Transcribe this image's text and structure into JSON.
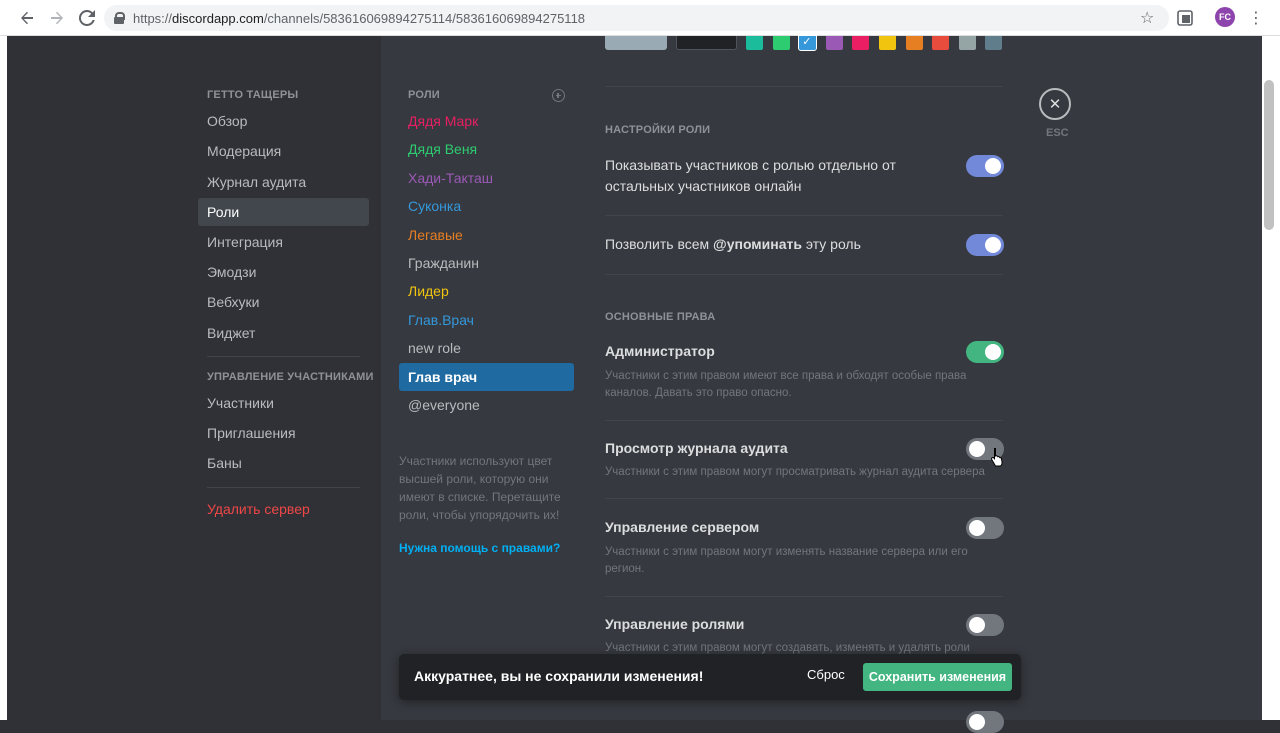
{
  "browser": {
    "url_scheme": "https://",
    "url_host": "discordapp.com",
    "url_path": "/channels/583616069894275114/583616069894275118",
    "avatar_initials": "FC"
  },
  "sidebar": {
    "server_section": "ГЕТТО ТАЩЕРЫ",
    "items": [
      {
        "label": "Обзор"
      },
      {
        "label": "Модерация"
      },
      {
        "label": "Журнал аудита"
      },
      {
        "label": "Роли",
        "active": true
      },
      {
        "label": "Интеграция"
      },
      {
        "label": "Эмодзи"
      },
      {
        "label": "Вебхуки"
      },
      {
        "label": "Виджет"
      }
    ],
    "members_section": "УПРАВЛЕНИЕ УЧАСТНИКАМИ",
    "member_items": [
      {
        "label": "Участники"
      },
      {
        "label": "Приглашения"
      },
      {
        "label": "Баны"
      }
    ],
    "delete_label": "Удалить сервер"
  },
  "roles": {
    "title": "РОЛИ",
    "items": [
      {
        "label": "Дядя Марк",
        "color": "#e91e63"
      },
      {
        "label": "Дядя Веня",
        "color": "#2ecc71"
      },
      {
        "label": "Хади-Такташ",
        "color": "#9b59b6"
      },
      {
        "label": "Суконка",
        "color": "#3498db"
      },
      {
        "label": "Легавые",
        "color": "#e67e22"
      },
      {
        "label": "Гражданин",
        "color": "#b9bbbe"
      },
      {
        "label": "Лидер",
        "color": "#f1c40f"
      },
      {
        "label": "Глав.Врач",
        "color": "#3498db"
      },
      {
        "label": "new role",
        "color": "#b9bbbe"
      },
      {
        "label": "Глав врач",
        "color": "#ffffff",
        "active": true
      },
      {
        "label": "@everyone",
        "color": "#b9bbbe"
      }
    ],
    "hint": "Участники используют цвет высшей роли, которую они имеют в списке. Перетащите роли, чтобы упорядочить их!",
    "help_link": "Нужна помощь с правами?"
  },
  "swatches": {
    "colors": [
      "#1abc9c",
      "#2ecc71",
      "#3498db",
      "#9b59b6",
      "#e91e63",
      "#f1c40f",
      "#e67e22",
      "#e74c3c",
      "#95a5a6",
      "#607d8b"
    ],
    "selected_index": 2,
    "default_color": "#99aab5",
    "custom_color": "#202225"
  },
  "role_settings": {
    "title": "НАСТРОЙКИ РОЛИ",
    "hoist_label_1": "Показывать участников с ролью отдельно от",
    "hoist_label_2": "остальных участников онлайн",
    "hoist_on": true,
    "mention_prefix": "Позволить всем ",
    "mention_bold": "@упоминать",
    "mention_suffix": " эту роль",
    "mention_on": true
  },
  "permissions": {
    "title": "ОСНОВНЫЕ ПРАВА",
    "items": [
      {
        "name": "Администратор",
        "desc_1": "Участники с этим правом имеют все права и обходят особые права",
        "desc_2": "каналов. Давать это право опасно.",
        "on": true
      },
      {
        "name": "Просмотр журнала аудита",
        "desc_1": "Участники с этим правом могут просматривать журнал аудита сервера",
        "desc_2": "",
        "on": false
      },
      {
        "name": "Управление сервером",
        "desc_1": "Участники с этим правом могут изменять название сервера или его",
        "desc_2": "регион.",
        "on": false
      },
      {
        "name": "Управление ролями",
        "desc_1": "Участники с этим правом могут создавать, изменять и удалять роли",
        "desc_2": "",
        "on": false
      }
    ]
  },
  "close": {
    "label": "ESC"
  },
  "notice": {
    "text": "Аккуратнее, вы не сохранили изменения!",
    "reset_label": "Сброс",
    "save_label": "Сохранить изменения"
  }
}
